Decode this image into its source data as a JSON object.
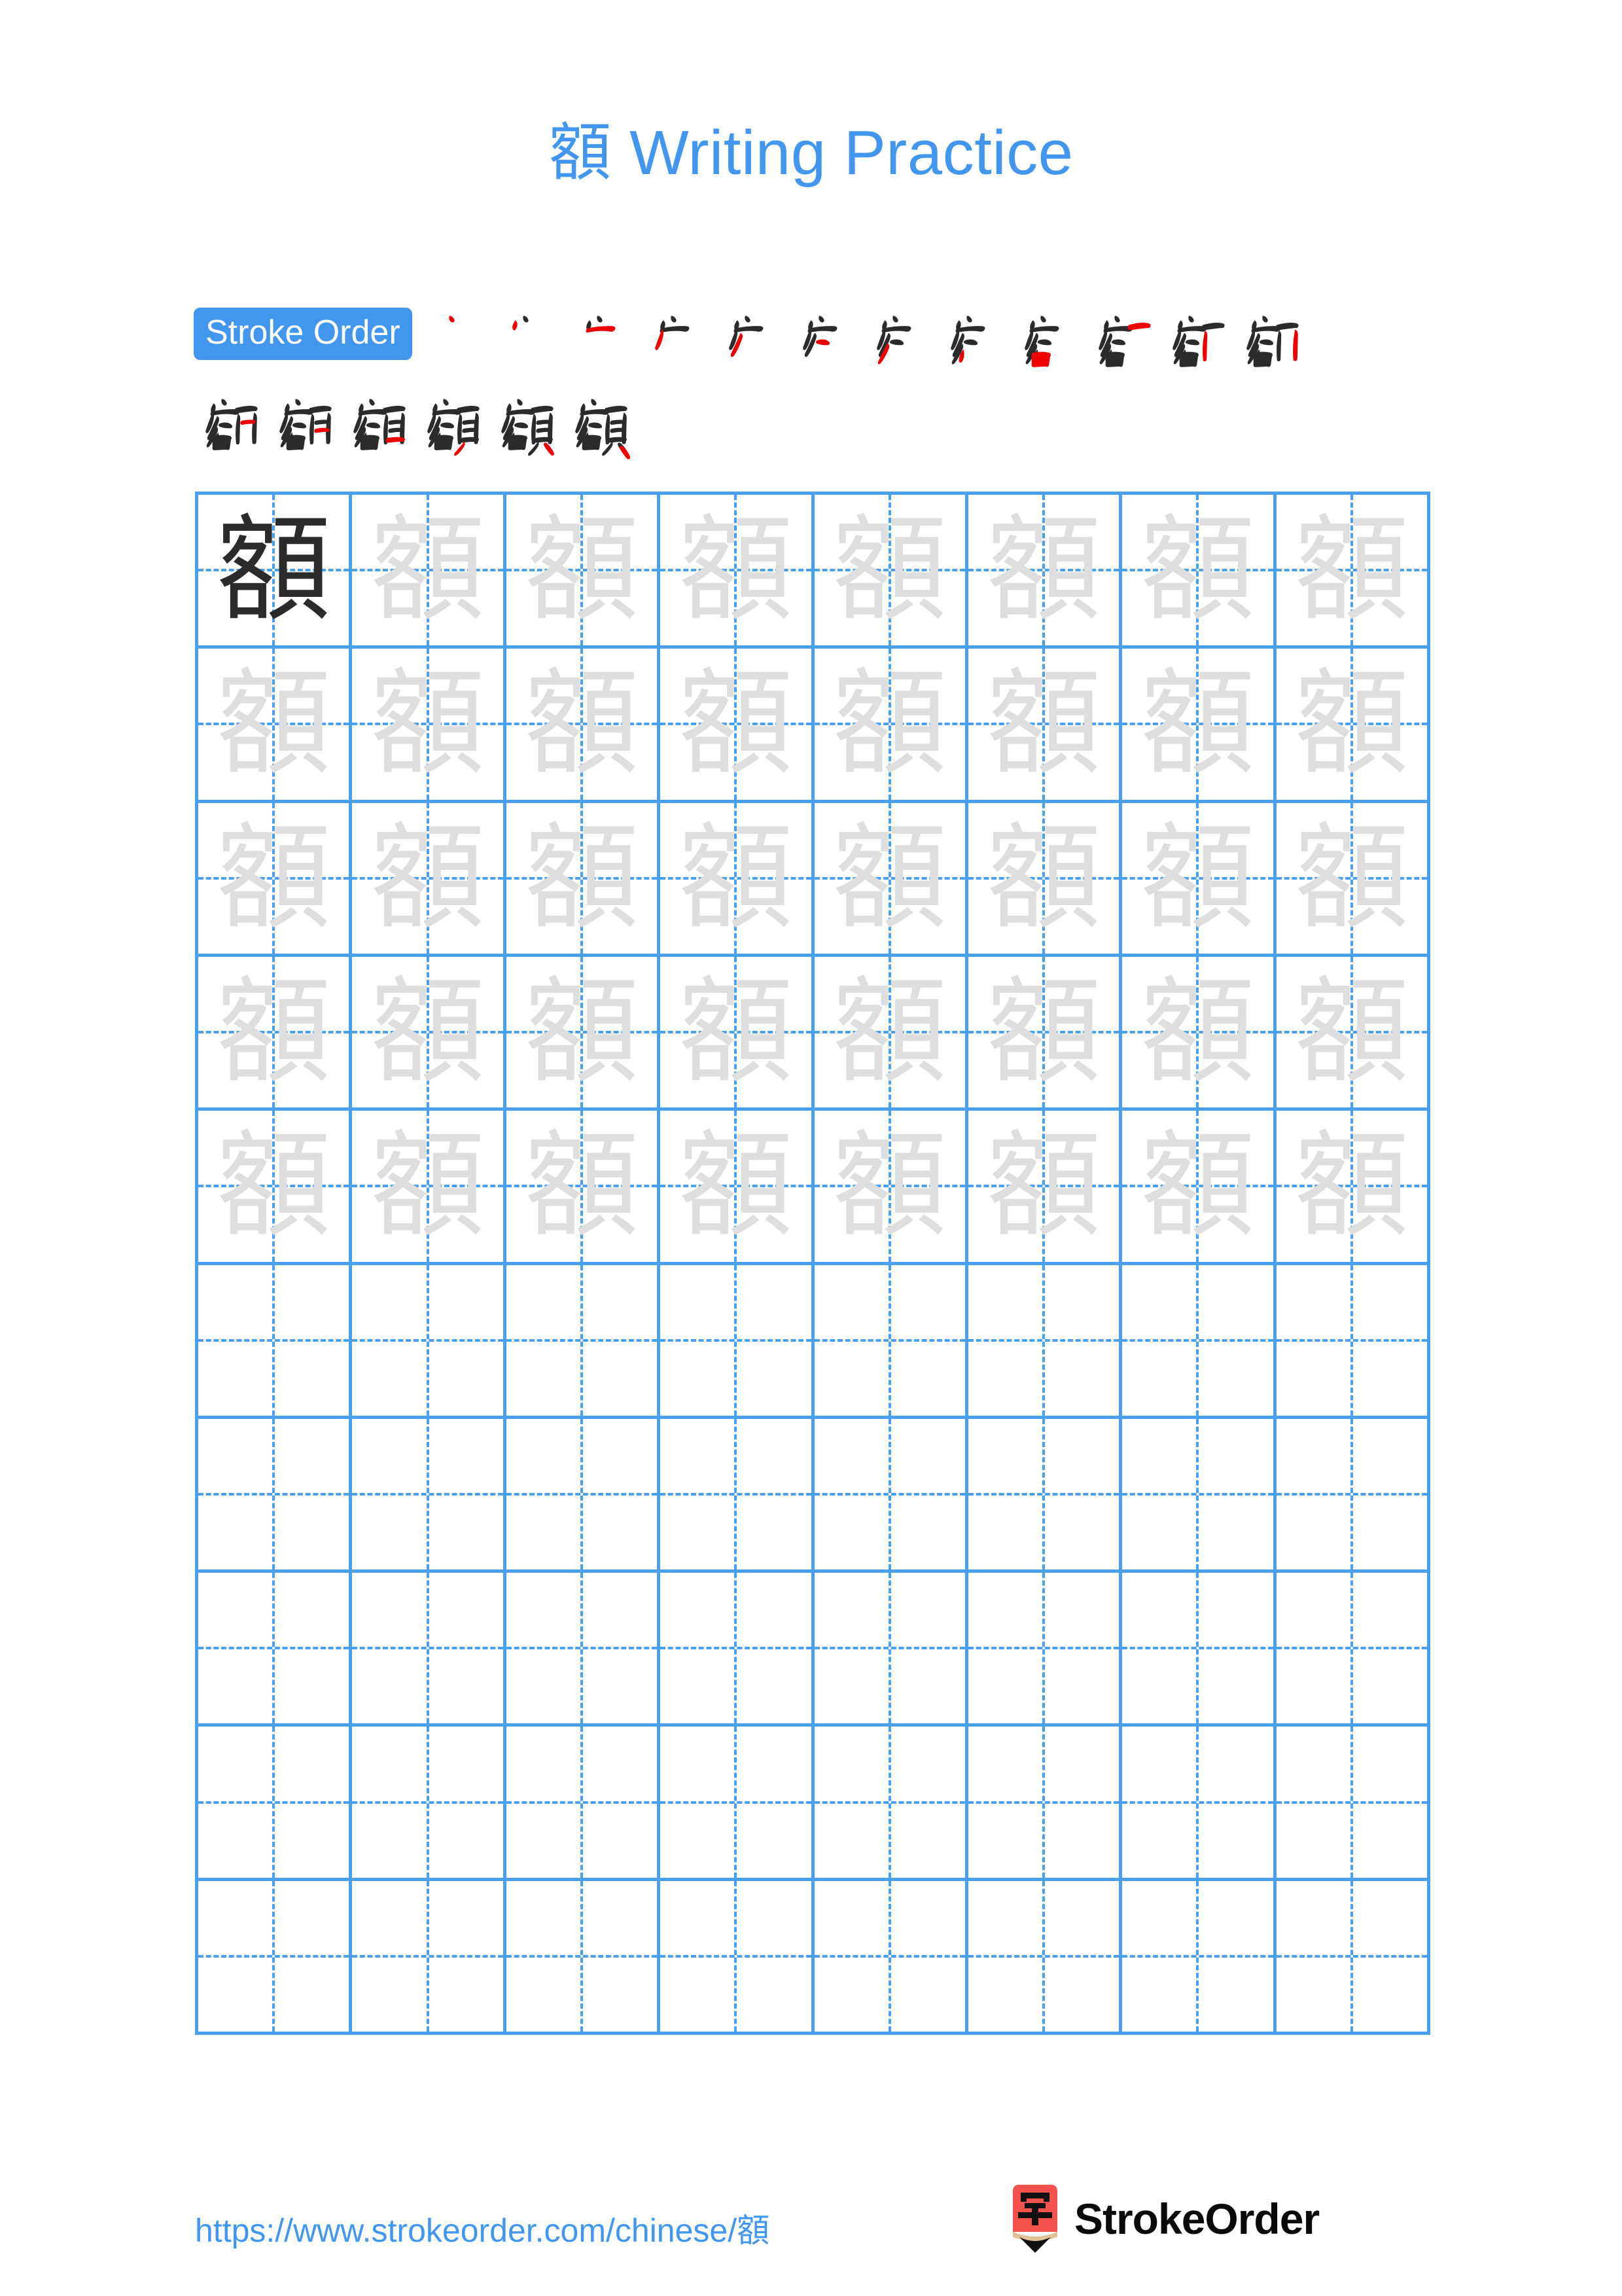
{
  "page": {
    "character": "額",
    "title_suffix": " Writing Practice",
    "title_full": "額 Writing Practice",
    "background_color": "#ffffff",
    "accent_color": "#4296EE",
    "grid_line_color": "#4aa0f0",
    "trace_color": "#dedede",
    "solid_color": "#2b2b2b",
    "new_stroke_color": "#ee0000"
  },
  "stroke_order": {
    "badge_label": "Stroke Order",
    "total_strokes": 18,
    "row1_count": 12,
    "row2_count": 6,
    "steps": [
      {
        "index": 1,
        "partial": "丶"
      },
      {
        "index": 2,
        "partial": "丷"
      },
      {
        "index": 3,
        "partial": "亠"
      },
      {
        "index": 4,
        "partial": "宀"
      },
      {
        "index": 5,
        "partial": "宀丿"
      },
      {
        "index": 6,
        "partial": "客上"
      },
      {
        "index": 7,
        "partial": "客上2"
      },
      {
        "index": 8,
        "partial": "客上3"
      },
      {
        "index": 9,
        "partial": "客"
      },
      {
        "index": 10,
        "partial": "客+丿"
      },
      {
        "index": 11,
        "partial": "客+丿亅"
      },
      {
        "index": 12,
        "partial": "客+頁1"
      },
      {
        "index": 13,
        "partial": "額13"
      },
      {
        "index": 14,
        "partial": "額14"
      },
      {
        "index": 15,
        "partial": "額15"
      },
      {
        "index": 16,
        "partial": "額16"
      },
      {
        "index": 17,
        "partial": "額17"
      },
      {
        "index": 18,
        "partial": "額"
      }
    ]
  },
  "practice_grid": {
    "columns": 8,
    "rows": 10,
    "filled_rows": 5,
    "blank_rows": 5,
    "character": "額",
    "cells": [
      [
        "solid",
        "trace",
        "trace",
        "trace",
        "trace",
        "trace",
        "trace",
        "trace"
      ],
      [
        "trace",
        "trace",
        "trace",
        "trace",
        "trace",
        "trace",
        "trace",
        "trace"
      ],
      [
        "trace",
        "trace",
        "trace",
        "trace",
        "trace",
        "trace",
        "trace",
        "trace"
      ],
      [
        "trace",
        "trace",
        "trace",
        "trace",
        "trace",
        "trace",
        "trace",
        "trace"
      ],
      [
        "trace",
        "trace",
        "trace",
        "trace",
        "trace",
        "trace",
        "trace",
        "trace"
      ],
      [
        "blank",
        "blank",
        "blank",
        "blank",
        "blank",
        "blank",
        "blank",
        "blank"
      ],
      [
        "blank",
        "blank",
        "blank",
        "blank",
        "blank",
        "blank",
        "blank",
        "blank"
      ],
      [
        "blank",
        "blank",
        "blank",
        "blank",
        "blank",
        "blank",
        "blank",
        "blank"
      ],
      [
        "blank",
        "blank",
        "blank",
        "blank",
        "blank",
        "blank",
        "blank",
        "blank"
      ],
      [
        "blank",
        "blank",
        "blank",
        "blank",
        "blank",
        "blank",
        "blank",
        "blank"
      ]
    ]
  },
  "footer": {
    "url": "https://www.strokeorder.com/chinese/額",
    "brand_name": "StrokeOrder",
    "logo_glyph": "字",
    "logo_body_color": "#F4524D",
    "logo_wood_color": "#E3C196",
    "logo_tip_color": "#111111"
  }
}
